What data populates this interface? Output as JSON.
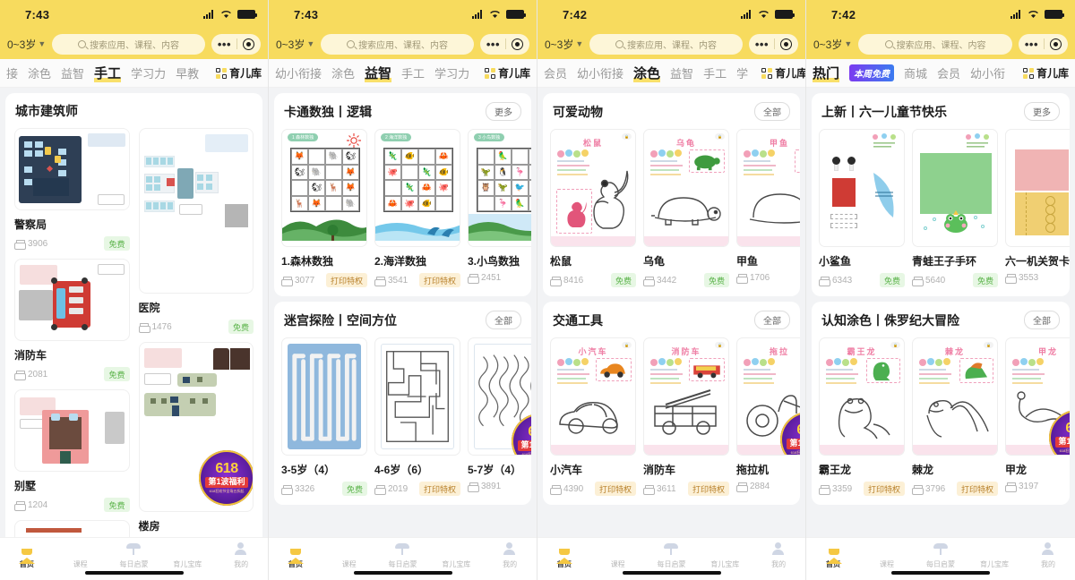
{
  "common": {
    "search_placeholder": "搜索应用、课程、内容",
    "age_selector": "0~3岁",
    "nav_right_label": "育儿库",
    "more_label": "更多",
    "all_label": "全部",
    "free_label": "免费",
    "privilege_label": "打印特权",
    "promo": {
      "line1": "618",
      "line2": "第1波福利",
      "line3": "618狂欢节全场五折起"
    },
    "accent_yellow": "#f7db5e",
    "free_color": "#5bb34a",
    "privilege_color": "#b8802a"
  },
  "bottom_nav": [
    {
      "label": "首页",
      "icon": "home-icon",
      "active": true
    },
    {
      "label": "课程",
      "icon": "course-icon",
      "active": false
    },
    {
      "label": "每日启蒙",
      "icon": "sprout-icon",
      "active": false
    },
    {
      "label": "育儿宝库",
      "icon": "folder-icon",
      "active": false
    },
    {
      "label": "我的",
      "icon": "person-icon",
      "active": false
    }
  ],
  "phones": [
    {
      "time": "7:43",
      "tabs": [
        {
          "label": "接",
          "active": false
        },
        {
          "label": "涂色",
          "active": false
        },
        {
          "label": "益智",
          "active": false
        },
        {
          "label": "手工",
          "active": true
        },
        {
          "label": "学习力",
          "active": false
        },
        {
          "label": "早教",
          "active": false
        }
      ],
      "sections": [
        {
          "title": "城市建筑师",
          "action": "",
          "layout": "masonry",
          "items": [
            {
              "name": "警察局",
              "count": "3906",
              "badge": "免费",
              "badge_type": "free",
              "art": "police"
            },
            {
              "name": "医院",
              "count": "1476",
              "badge": "免费",
              "badge_type": "free",
              "art": "hospital"
            },
            {
              "name": "消防车",
              "count": "2081",
              "badge": "免费",
              "badge_type": "free",
              "art": "firetruck"
            },
            {
              "name": "别墅",
              "count": "1204",
              "badge": "免费",
              "badge_type": "free",
              "art": "villa"
            },
            {
              "name": "楼房",
              "count": "",
              "badge": "",
              "badge_type": "",
              "art": "building"
            }
          ]
        }
      ]
    },
    {
      "time": "7:43",
      "tabs": [
        {
          "label": "幼小衔接",
          "active": false
        },
        {
          "label": "涂色",
          "active": false
        },
        {
          "label": "益智",
          "active": true
        },
        {
          "label": "手工",
          "active": false
        },
        {
          "label": "学习力",
          "active": false
        }
      ],
      "sections": [
        {
          "title": "卡通数独丨逻辑",
          "action": "更多",
          "layout": "row",
          "items": [
            {
              "name": "1.森林数独",
              "count": "3077",
              "badge": "打印特权",
              "badge_type": "priv",
              "art": "sudoku-forest",
              "tag": "1 森林数独"
            },
            {
              "name": "2.海洋数独",
              "count": "3541",
              "badge": "打印特权",
              "badge_type": "priv",
              "art": "sudoku-ocean",
              "tag": "2 海洋数独"
            },
            {
              "name": "3.小鸟数独",
              "count": "2451",
              "badge": "",
              "badge_type": "priv",
              "art": "sudoku-bird",
              "tag": "3 小鸟数独"
            }
          ]
        },
        {
          "title": "迷宫探险丨空间方位",
          "action": "全部",
          "layout": "row",
          "items": [
            {
              "name": "3-5岁（4）",
              "count": "3326",
              "badge": "免费",
              "badge_type": "free",
              "art": "maze-blue"
            },
            {
              "name": "4-6岁（6）",
              "count": "2019",
              "badge": "打印特权",
              "badge_type": "priv",
              "art": "maze-square"
            },
            {
              "name": "5-7岁（4）",
              "count": "3891",
              "badge": "",
              "badge_type": "priv",
              "art": "maze-round",
              "promo": true
            }
          ]
        }
      ]
    },
    {
      "time": "7:42",
      "tabs": [
        {
          "label": "会员",
          "active": false
        },
        {
          "label": "幼小衔接",
          "active": false
        },
        {
          "label": "涂色",
          "active": true
        },
        {
          "label": "益智",
          "active": false
        },
        {
          "label": "手工",
          "active": false
        },
        {
          "label": "学",
          "active": false
        }
      ],
      "sections": [
        {
          "title": "可爱动物",
          "action": "全部",
          "layout": "row",
          "items": [
            {
              "name": "松鼠",
              "count": "8416",
              "badge": "免费",
              "badge_type": "free",
              "art": "squirrel",
              "tag": "松鼠"
            },
            {
              "name": "乌龟",
              "count": "3442",
              "badge": "免费",
              "badge_type": "free",
              "art": "turtle",
              "tag": "乌龟"
            },
            {
              "name": "甲鱼",
              "count": "1706",
              "badge": "",
              "badge_type": "free",
              "art": "softshell",
              "tag": "甲鱼"
            }
          ]
        },
        {
          "title": "交通工具",
          "action": "全部",
          "layout": "row",
          "items": [
            {
              "name": "小汽车",
              "count": "4390",
              "badge": "打印特权",
              "badge_type": "priv",
              "art": "car",
              "tag": "小汽车"
            },
            {
              "name": "消防车",
              "count": "3611",
              "badge": "打印特权",
              "badge_type": "priv",
              "art": "firetruck2",
              "tag": "消防车"
            },
            {
              "name": "拖拉机",
              "count": "2884",
              "badge": "",
              "badge_type": "priv",
              "art": "tractor",
              "tag": "拖拉",
              "promo": true
            }
          ]
        }
      ]
    },
    {
      "time": "7:42",
      "tabs": [
        {
          "label": "热门",
          "active": true
        },
        {
          "label": "本周免费",
          "active": false,
          "is_badge": true
        },
        {
          "label": "商城",
          "active": false
        },
        {
          "label": "会员",
          "active": false
        },
        {
          "label": "幼小衔",
          "active": false
        }
      ],
      "sections": [
        {
          "title": "上新丨六一儿童节快乐",
          "action": "更多",
          "layout": "row",
          "items": [
            {
              "name": "小鲨鱼",
              "count": "6343",
              "badge": "免费",
              "badge_type": "free",
              "art": "shark"
            },
            {
              "name": "青蛙王子手环",
              "count": "5640",
              "badge": "免费",
              "badge_type": "free",
              "art": "frog"
            },
            {
              "name": "六一机关贺卡",
              "count": "3553",
              "badge": "",
              "badge_type": "free",
              "art": "card"
            }
          ]
        },
        {
          "title": "认知涂色丨侏罗纪大冒险",
          "action": "全部",
          "layout": "row",
          "items": [
            {
              "name": "霸王龙",
              "count": "3359",
              "badge": "打印特权",
              "badge_type": "priv",
              "art": "trex",
              "tag": "霸王龙"
            },
            {
              "name": "棘龙",
              "count": "3796",
              "badge": "打印特权",
              "badge_type": "priv",
              "art": "spino",
              "tag": "棘龙"
            },
            {
              "name": "甲龙",
              "count": "3197",
              "badge": "",
              "badge_type": "priv",
              "art": "anky",
              "tag": "甲龙",
              "promo": true
            }
          ]
        }
      ]
    }
  ]
}
